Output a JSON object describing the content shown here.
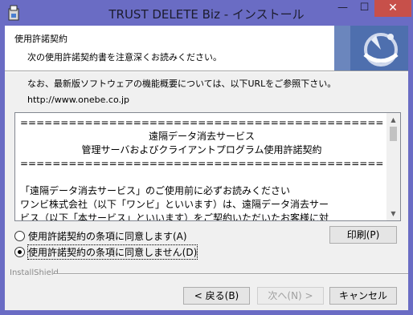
{
  "window": {
    "title": "TRUST DELETE Biz - インストール",
    "min_symbol": "—",
    "max_symbol": "☐",
    "close_symbol": "✕"
  },
  "header": {
    "title": "使用許諾契約",
    "subtitle": "次の使用許諾契約書を注意深くお読みください。"
  },
  "notice": "なお、最新版ソフトウェアの機能概要については、以下URLをご参照下さい。",
  "url": "http://www.onebe.co.jp",
  "license": {
    "lines": [
      "=================================================",
      "遠隔データ消去サービス",
      "管理サーバおよびクライアントプログラム使用許諾契約",
      "=================================================",
      "",
      "「遠隔データ消去サービス」のご使用前に必ずお読みください",
      "ワンビ株式会社（以下「ワンビ」といいます）は、遠隔データ消去サー",
      "ビス（以下「本サービス」といいます）をご契約いただいたお客様に対"
    ],
    "scroll_up": "▲",
    "scroll_down": "▼"
  },
  "options": {
    "accept": "使用許諾契約の条項に同意します(A)",
    "decline": "使用許諾契約の条項に同意しません(D)",
    "selected": "decline"
  },
  "buttons": {
    "print": "印刷(P)",
    "back": "< 戻る(B)",
    "next": "次へ(N) >",
    "cancel": "キャンセル"
  },
  "brand": "InstallShield",
  "colors": {
    "titlebar": "#6a6cc4",
    "close": "#c7504a",
    "face": "#f0f0f0"
  },
  "icons": {
    "app": "installer-icon",
    "logo": "installshield-logo"
  }
}
